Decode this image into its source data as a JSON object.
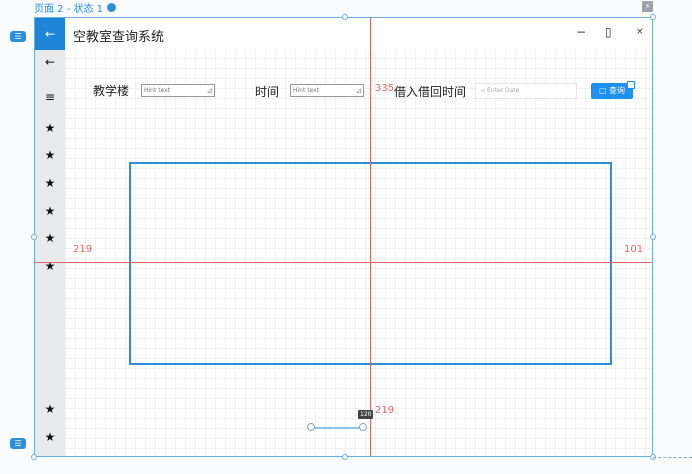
{
  "page_label": "页面 2 - 状态 1",
  "app": {
    "title": "空教室查询系统",
    "back_icon": "←"
  },
  "window": {
    "minimize": "−",
    "maximize": "▯",
    "close": "×"
  },
  "sidebar": {
    "back": "←",
    "menu": "≡",
    "star": "★"
  },
  "form": {
    "building_label": "教学楼",
    "building_placeholder": "Hint text",
    "time_label": "时间",
    "time_placeholder": "Hint text",
    "return_label": "借入借回时间",
    "date_placeholder": "Enter Date",
    "query_button": "查询"
  },
  "measurements": {
    "top": "335",
    "left": "219",
    "right": "101",
    "bottom": "219",
    "slider_tooltip": "120"
  },
  "colors": {
    "accent": "#1f86d7",
    "guide": "#e06666",
    "sidebar": "#e9eaec"
  }
}
